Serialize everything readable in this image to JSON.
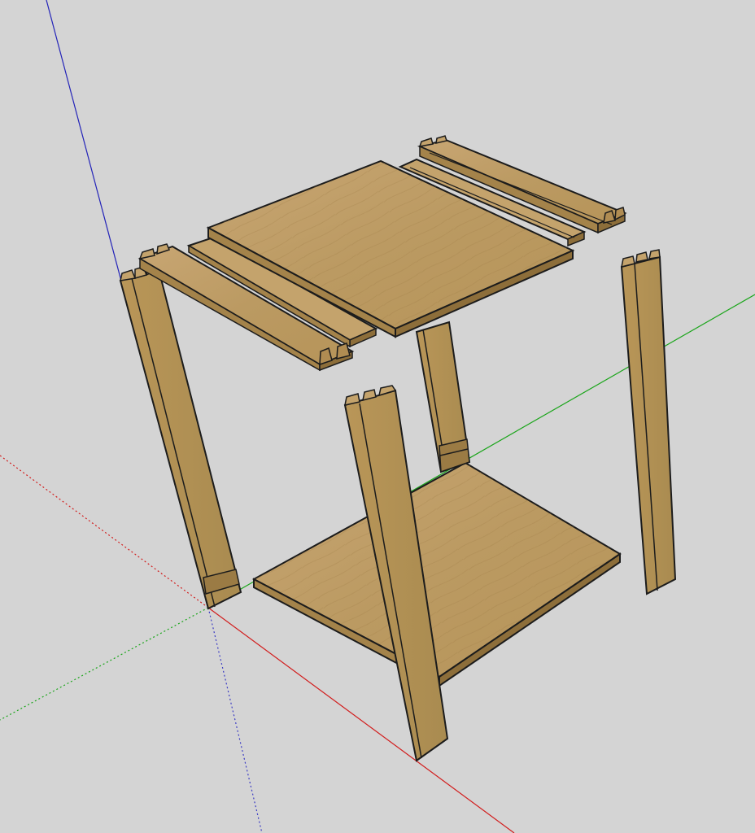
{
  "viewport": {
    "background": "#d4d4d4"
  },
  "axes": {
    "red_axis_color": "#d21d1d",
    "green_axis_color": "#1aa51a",
    "blue_axis_color": "#2323b8"
  },
  "model": {
    "parts": [
      "back-left-leg",
      "front-left-leg",
      "back-right-leg",
      "right-leg",
      "top-shelf",
      "bottom-shelf",
      "left-rail",
      "left-rail-slotted",
      "right-rail",
      "right-rail-slotted"
    ],
    "wood_light": "#c7a572",
    "wood_mid": "#b08c52",
    "wood_dark": "#8d6e3a",
    "edge_color": "#1c1c1c"
  }
}
